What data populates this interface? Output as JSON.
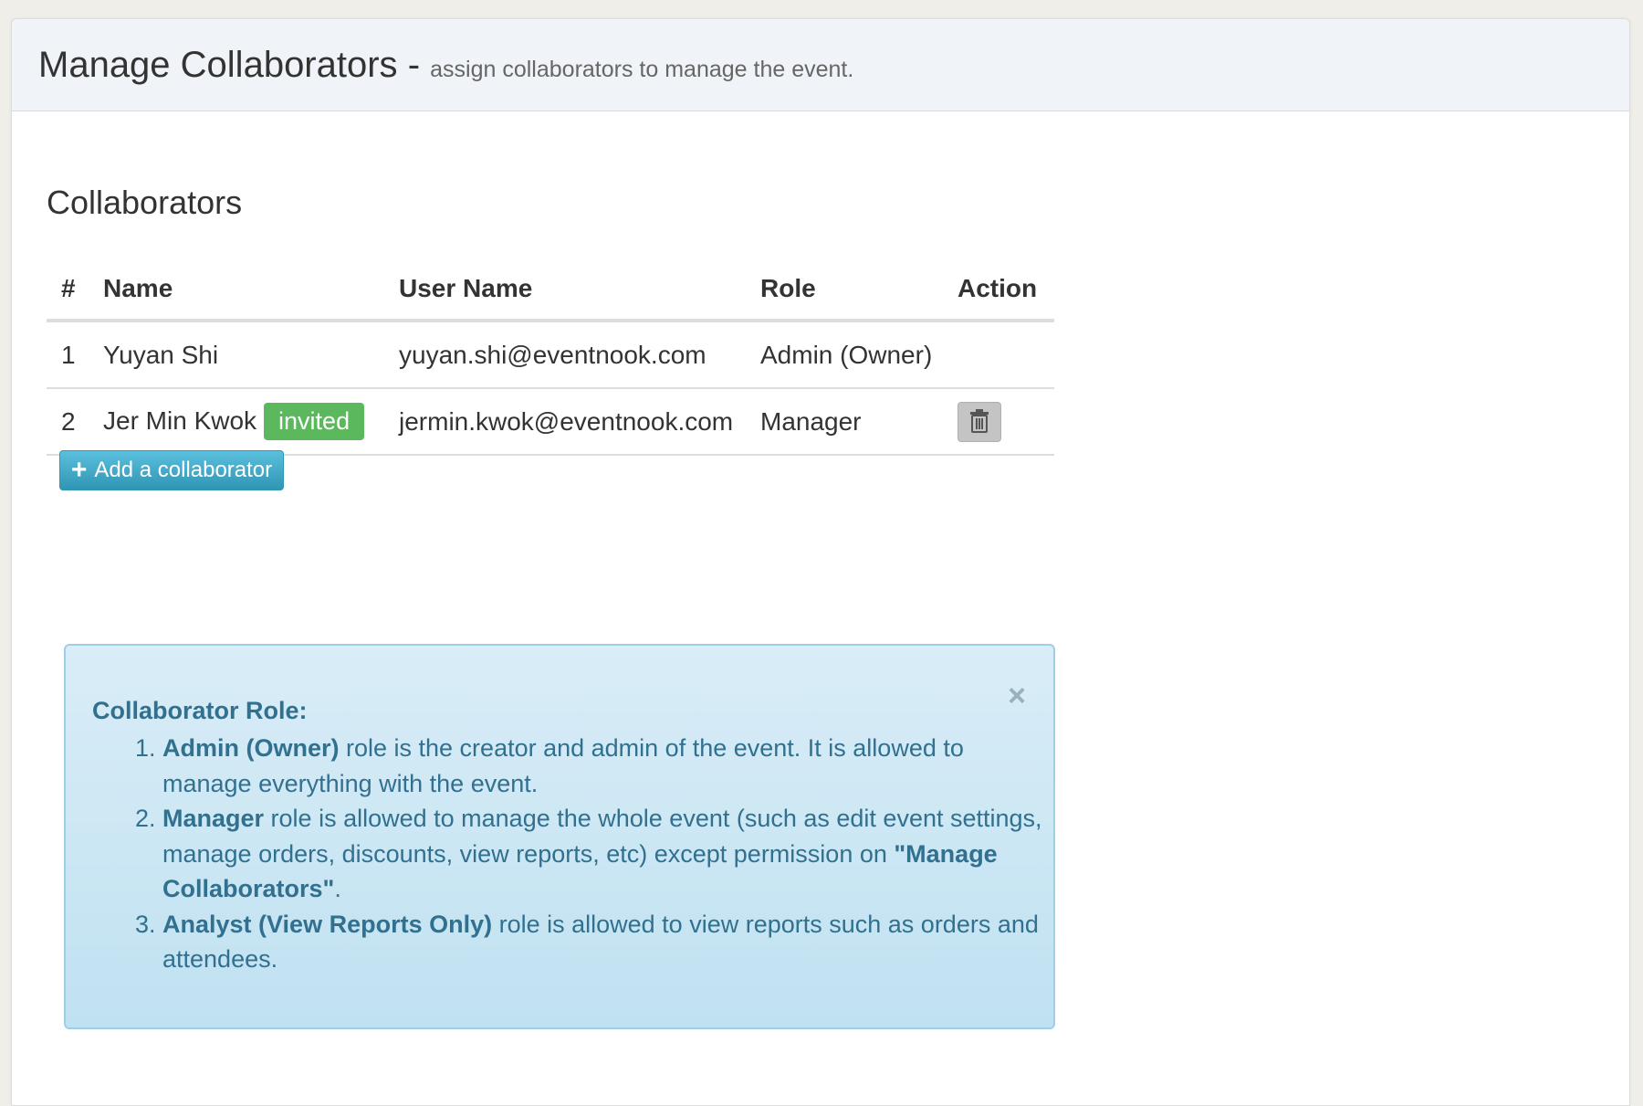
{
  "header": {
    "title": "Manage Collaborators",
    "separator": "-",
    "subtitle": "assign collaborators to manage the event."
  },
  "section": {
    "title": "Collaborators"
  },
  "table": {
    "columns": [
      "#",
      "Name",
      "User Name",
      "Role",
      "Action"
    ],
    "rows": [
      {
        "num": "1",
        "name": "Yuyan Shi",
        "badge": "",
        "username": "yuyan.shi@eventnook.com",
        "role": "Admin (Owner)"
      },
      {
        "num": "2",
        "name": "Jer Min Kwok",
        "badge": "invited",
        "username": "jermin.kwok@eventnook.com",
        "role": "Manager"
      }
    ],
    "delete_icon": "trash-icon"
  },
  "add_button": {
    "icon": "plus-icon",
    "label": "Add a collaborator"
  },
  "info": {
    "title": "Collaborator Role:",
    "close": "×",
    "items": [
      {
        "bold": "Admin (Owner)",
        "text": " role is the creator and admin of the event. It is allowed to manage everything with the event."
      },
      {
        "bold": "Manager",
        "text": " role is allowed to manage the whole event (such as edit event settings, manage orders, discounts, view reports, etc) except permission on ",
        "bold2": "\"Manage Collaborators\"",
        "text2": "."
      },
      {
        "bold": "Analyst (View Reports Only)",
        "text": " role is allowed to view reports such as orders and attendees."
      }
    ]
  },
  "colors": {
    "badge": "#5cb85c",
    "button": "#3aa8cf",
    "info_bg": "#d9edf7",
    "info_text": "#31708f"
  }
}
